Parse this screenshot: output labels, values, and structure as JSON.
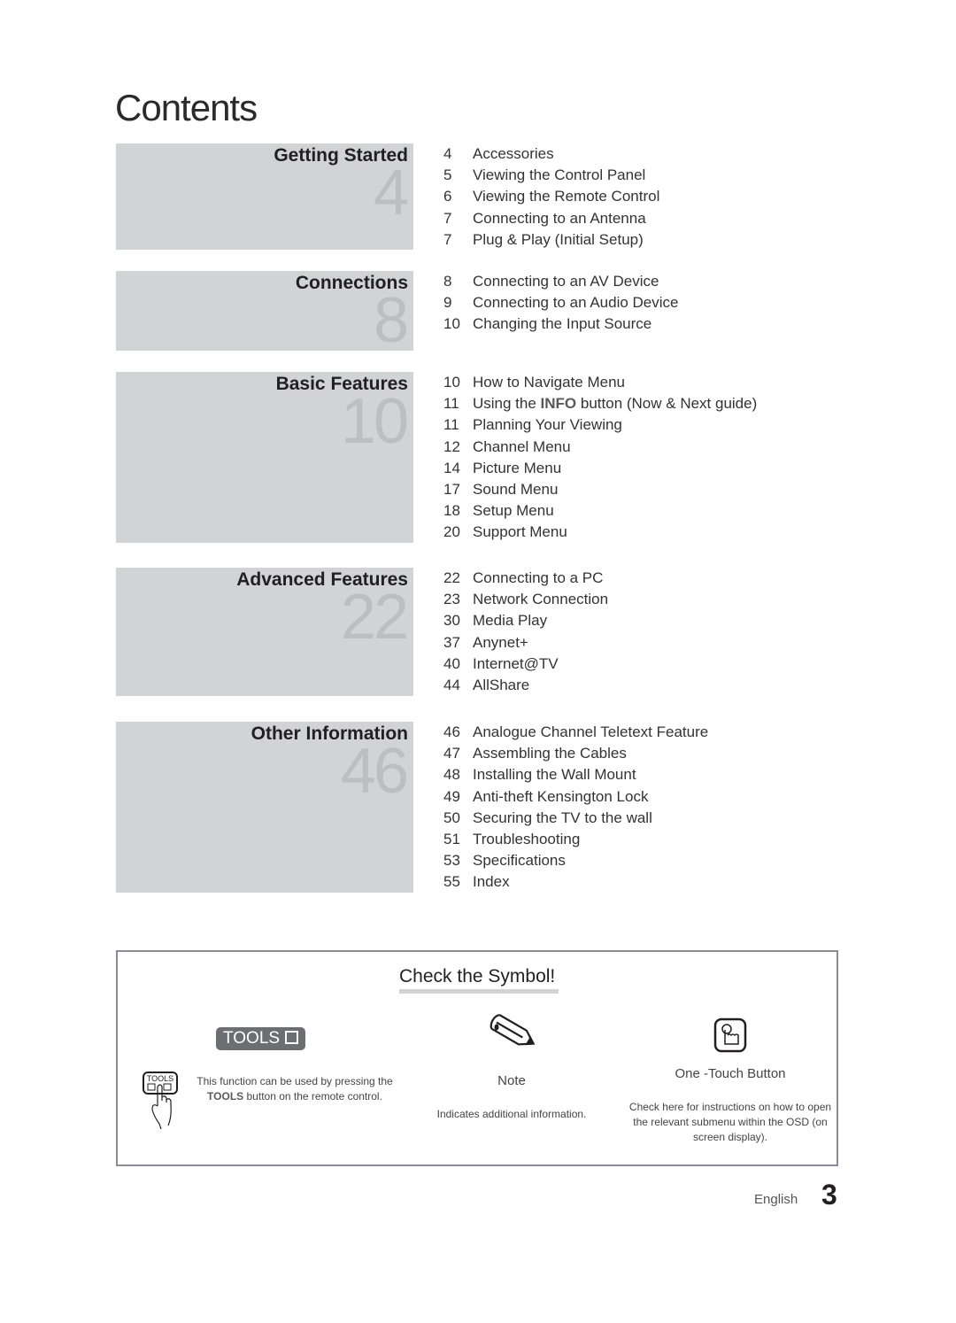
{
  "page_title": "Contents",
  "sections": [
    {
      "title": "Getting Started",
      "start_page": "4",
      "items": [
        {
          "page": "4",
          "label": "Accessories"
        },
        {
          "page": "5",
          "label": "Viewing the Control Panel"
        },
        {
          "page": "6",
          "label": "Viewing the Remote Control"
        },
        {
          "page": "7",
          "label": "Connecting to an Antenna"
        },
        {
          "page": "7",
          "label": "Plug & Play (Initial Setup)"
        }
      ]
    },
    {
      "title": "Connections",
      "start_page": "8",
      "items": [
        {
          "page": "8",
          "label": "Connecting to an AV Device"
        },
        {
          "page": "9",
          "label": "Connecting to an Audio Device"
        },
        {
          "page": "10",
          "label": "Changing the Input Source"
        }
      ]
    },
    {
      "title": "Basic Features",
      "start_page": "10",
      "items": [
        {
          "page": "10",
          "label": "How to Navigate Menu"
        },
        {
          "page": "11",
          "label_pre": "Using the ",
          "label_hl": "INFO",
          "label_post": " button (Now & Next guide)"
        },
        {
          "page": "11",
          "label": "Planning Your Viewing"
        },
        {
          "page": "12",
          "label": "Channel Menu"
        },
        {
          "page": "14",
          "label": "Picture Menu"
        },
        {
          "page": "17",
          "label": "Sound Menu"
        },
        {
          "page": "18",
          "label": "Setup Menu"
        },
        {
          "page": "20",
          "label": "Support Menu"
        }
      ]
    },
    {
      "title": "Advanced Features",
      "start_page": "22",
      "items": [
        {
          "page": "22",
          "label": "Connecting to a PC"
        },
        {
          "page": "23",
          "label": "Network Connection"
        },
        {
          "page": "30",
          "label": "Media Play"
        },
        {
          "page": "37",
          "label": "Anynet+"
        },
        {
          "page": "40",
          "label": "Internet@TV"
        },
        {
          "page": "44",
          "label": "AllShare"
        }
      ]
    },
    {
      "title": "Other Information",
      "start_page": "46",
      "items": [
        {
          "page": "46",
          "label": "Analogue Channel Teletext Feature"
        },
        {
          "page": "47",
          "label": "Assembling the Cables"
        },
        {
          "page": "48",
          "label": "Installing the Wall Mount"
        },
        {
          "page": "49",
          "label": "Anti-theft Kensington Lock"
        },
        {
          "page": "50",
          "label": "Securing the TV to the wall"
        },
        {
          "page": "51",
          "label": "Troubleshooting"
        },
        {
          "page": "53",
          "label": "Specifications"
        },
        {
          "page": "55",
          "label": "Index"
        }
      ]
    }
  ],
  "symbols": {
    "title": "Check the Symbol!",
    "tools": {
      "badge_label": "TOOLS",
      "remote_label": "TOOLS",
      "desc_line1": "This function can be used by pressing the",
      "desc_hl": "TOOLS",
      "desc_line2": " button on the remote control."
    },
    "note": {
      "label": "Note",
      "desc": "Indicates additional information."
    },
    "one_touch": {
      "label": "One -Touch Button",
      "desc": "Check here for instructions on how to open the relevant submenu within the OSD (on screen display)."
    }
  },
  "footer": {
    "language": "English",
    "page_number": "3"
  }
}
